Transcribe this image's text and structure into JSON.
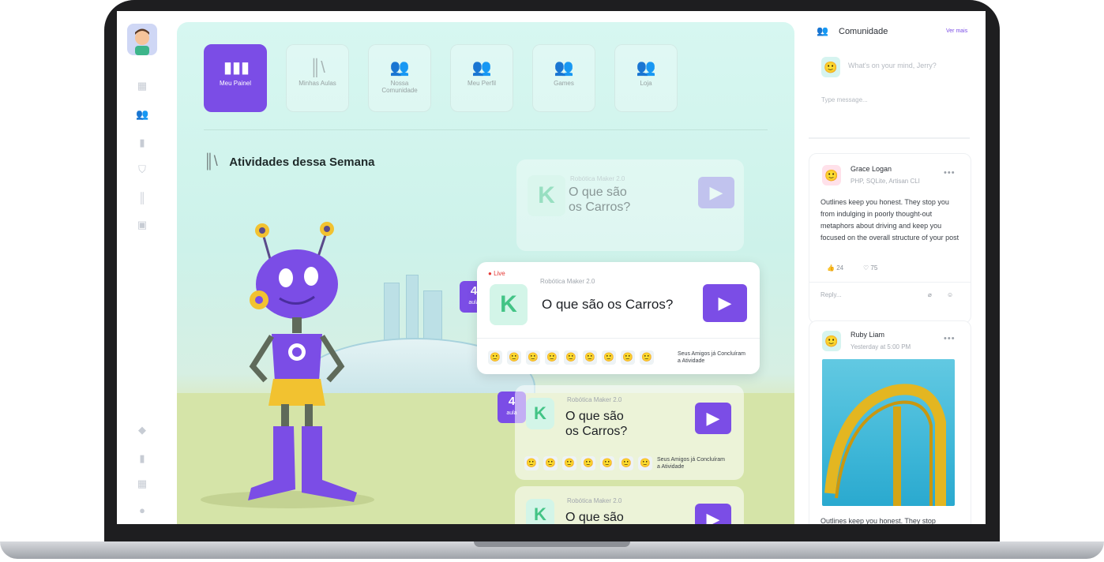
{
  "nav": [
    {
      "label": "Meu Painel",
      "icon": "bar-chart-icon",
      "active": true
    },
    {
      "label": "Minhas Aulas",
      "icon": "books-icon",
      "active": false
    },
    {
      "label": "Nossa Comunidade",
      "icon": "users-icon",
      "active": false
    },
    {
      "label": "Meu Perfil",
      "icon": "users-icon",
      "active": false
    },
    {
      "label": "Games",
      "icon": "users-icon",
      "active": false
    },
    {
      "label": "Loja",
      "icon": "users-icon",
      "active": false
    }
  ],
  "section": {
    "title": "Atividades dessa Semana"
  },
  "activities": {
    "live_label": "Live",
    "badge_number": "4",
    "badge_unit": "aula",
    "course": "Robótica Maker 2.0",
    "title": "O que são os Carros?",
    "title_line1": "O que são",
    "title_line2": "os Carros?",
    "friends_text": "Seus Amigos já Concluíram a Atividade"
  },
  "community": {
    "title": "Comunidade",
    "see_more": "Ver mais",
    "composer_placeholder": "What's on your mind, Jerry?",
    "message_placeholder": "Type message..."
  },
  "posts": [
    {
      "author": "Grace Logan",
      "meta": "PHP, SQLite, Artisan CLI",
      "body": "Outlines keep you honest. They stop you from indulging in poorly thought-out metaphors about driving and keep you focused on the overall structure of your post",
      "likes": "24",
      "hearts": "75",
      "reply_placeholder": "Reply..."
    },
    {
      "author": "Ruby Liam",
      "meta": "Yesterday at 5:00 PM",
      "body_preview": "Outlines keep you honest. They stop"
    }
  ],
  "colors": {
    "accent": "#7b4de6",
    "logo_green": "#43c486",
    "live_red": "#e53935"
  }
}
